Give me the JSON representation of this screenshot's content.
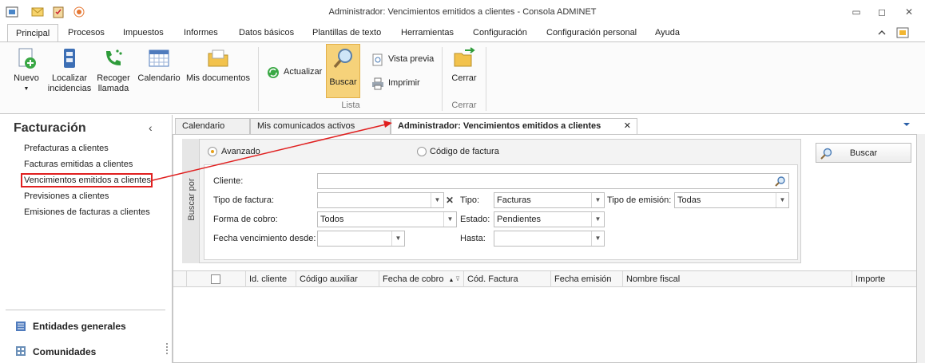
{
  "window": {
    "title": "Administrador: Vencimientos emitidos a clientes - Consola ADMINET",
    "controls": [
      "▭",
      "◻",
      "✕"
    ]
  },
  "ribbon": {
    "tabs": [
      "Principal",
      "Procesos",
      "Impuestos",
      "Informes",
      "Datos básicos",
      "Plantillas de texto",
      "Herramientas",
      "Configuración",
      "Configuración personal",
      "Ayuda"
    ],
    "active_tab": "Principal",
    "buttons": {
      "nuevo": "Nuevo",
      "localizar": "Localizar incidencias",
      "recoger": "Recoger llamada",
      "calendario": "Calendario",
      "mis_documentos": "Mis documentos",
      "actualizar": "Actualizar",
      "buscar": "Buscar",
      "vista_previa": "Vista previa",
      "imprimir": "Imprimir",
      "cerrar": "Cerrar"
    },
    "groups": {
      "lista": "Lista",
      "cerrar": "Cerrar"
    }
  },
  "sidebar": {
    "title": "Facturación",
    "collapse": "‹",
    "links": [
      "Prefacturas a clientes",
      "Facturas emitidas a clientes",
      "Vencimientos emitidos a clientes",
      "Previsiones a clientes",
      "Emisiones de facturas a clientes"
    ],
    "selected_index": 2,
    "groups": [
      "Entidades generales",
      "Comunidades"
    ]
  },
  "doc_tabs": {
    "items": [
      "Calendario",
      "Mis comunicados activos",
      "Administrador: Vencimientos emitidos a clientes"
    ],
    "active_index": 2,
    "close": "✕"
  },
  "search": {
    "side_label": "Buscar por",
    "mode_avanzado": "Avanzado",
    "mode_codigo": "Código de factura",
    "buscar_button": "Buscar",
    "cliente_label": "Cliente:",
    "cliente_value": "",
    "tipo_factura_label": "Tipo de factura:",
    "tipo_factura_value": "",
    "tipo_label": "Tipo:",
    "tipo_value": "Facturas",
    "tipo_emision_label": "Tipo de emisión:",
    "tipo_emision_value": "Todas",
    "forma_cobro_label": "Forma de cobro:",
    "forma_cobro_value": "Todos",
    "estado_label": "Estado:",
    "estado_value": "Pendientes",
    "fecha_desde_label": "Fecha vencimiento desde:",
    "fecha_desde_value": "",
    "hasta_label": "Hasta:",
    "hasta_value": ""
  },
  "grid": {
    "columns": [
      "Id. cliente",
      "Código auxiliar",
      "Fecha de cobro",
      "Cód. Factura",
      "Fecha emisión",
      "Nombre fiscal",
      "Importe"
    ]
  },
  "colors": {
    "accent_orange": "#f3c253",
    "highlight_red": "#e02020"
  }
}
